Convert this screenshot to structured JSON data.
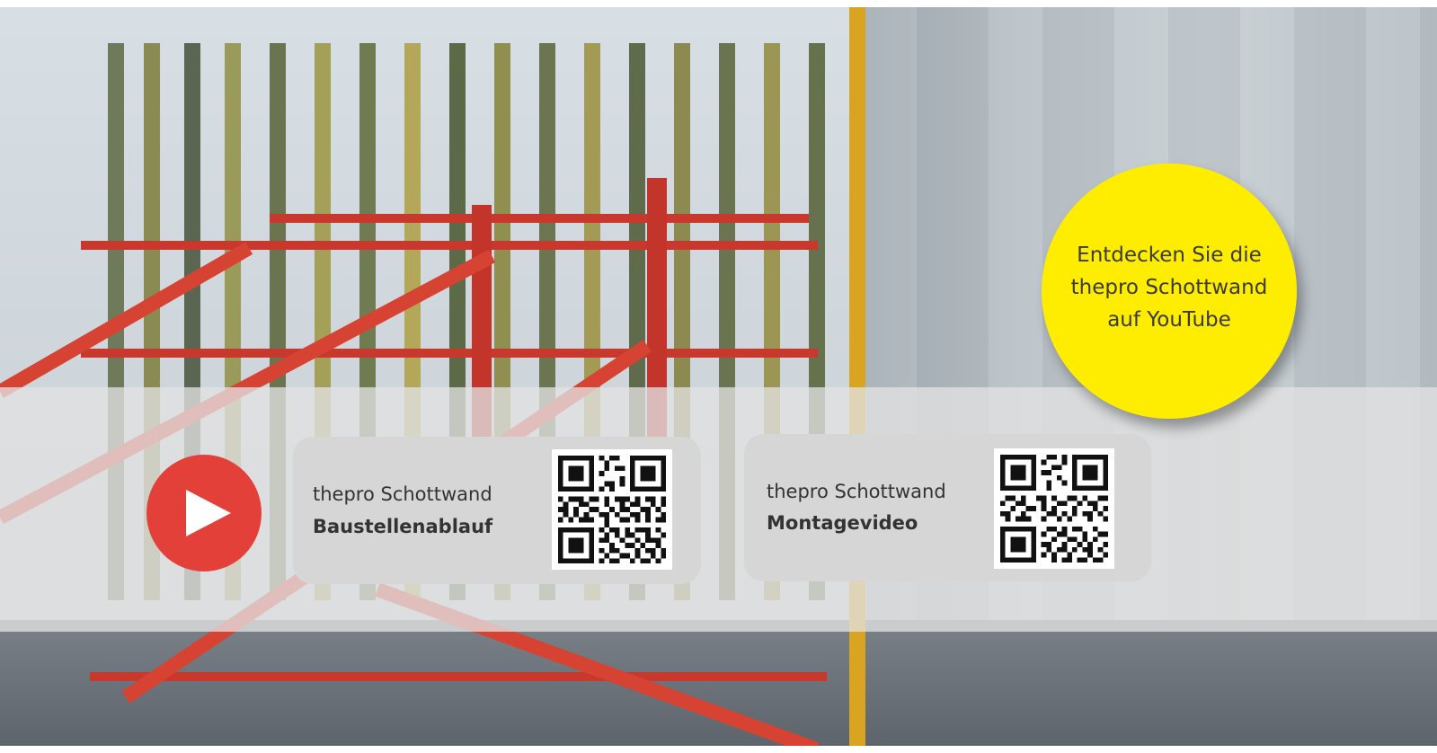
{
  "banner": {
    "title_lines": [
      "Entdecken Sie die",
      "thepro Schottwand",
      "auf YouTube"
    ]
  },
  "play_icon": "youtube-play-icon",
  "colors": {
    "circle": "#ffed00",
    "play": "#e3403a",
    "card": "#d6d6d6",
    "band": "#e1e1e1"
  },
  "videos": [
    {
      "subtitle": "thepro Schottwand",
      "title": "Baustellenablauf",
      "qr_icon": "qr-code-icon"
    },
    {
      "subtitle": "thepro Schottwand",
      "title": "Montagevideo",
      "qr_icon": "qr-code-icon"
    }
  ]
}
